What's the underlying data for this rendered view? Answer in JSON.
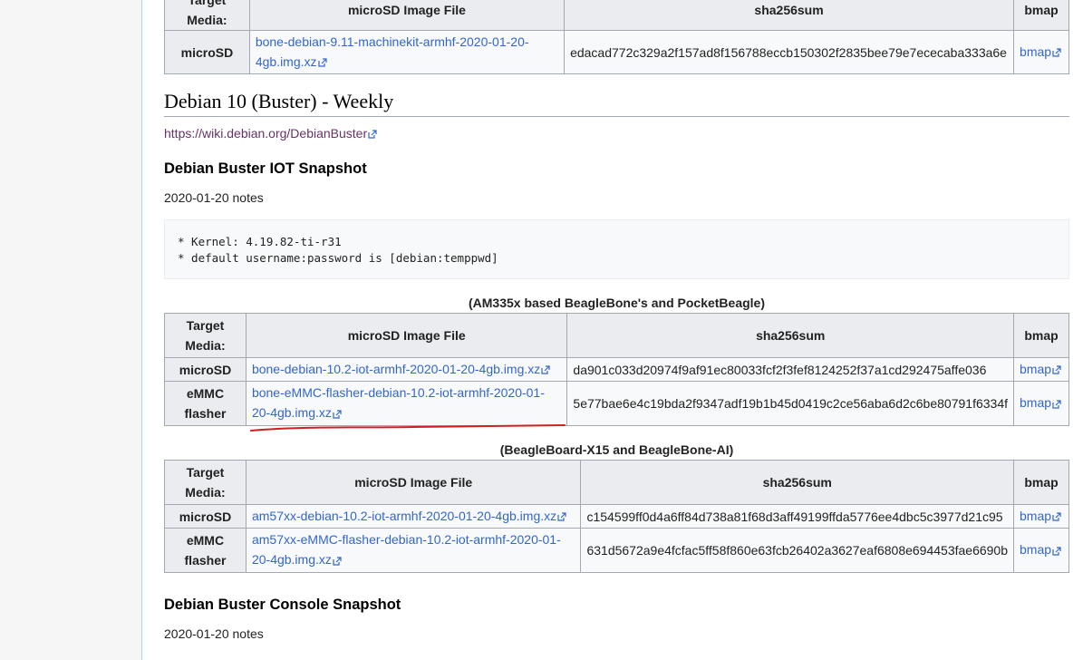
{
  "table_top": {
    "headers": [
      "Target Media:",
      "microSD Image File",
      "sha256sum",
      "bmap"
    ],
    "rows": [
      {
        "media": "microSD",
        "file": "bone-debian-9.11-machinekit-armhf-2020-01-20-4gb.img.xz",
        "sha": "edacad772c329a2f157ad8f156788eccb150302f2835bee79e7ececaba333a6e",
        "bmap": "bmap"
      }
    ]
  },
  "section": {
    "title": "Debian 10 (Buster) - Weekly",
    "link": "https://wiki.debian.org/DebianBuster"
  },
  "iot": {
    "title": "Debian Buster IOT Snapshot",
    "notes": "2020-01-20 notes",
    "pre_line1": "* Kernel: 4.19.82-ti-r31",
    "pre_line2": "* default username:password is [debian:temppwd]"
  },
  "table_am335x": {
    "caption": "(AM335x based BeagleBone's and PocketBeagle)",
    "headers": [
      "Target Media:",
      "microSD Image File",
      "sha256sum",
      "bmap"
    ],
    "rows": [
      {
        "media": "microSD",
        "file": "bone-debian-10.2-iot-armhf-2020-01-20-4gb.img.xz",
        "sha": "da901c033d20974f9af91ec80033fcf2f3fef8124252f37a1cd292475affe036",
        "bmap": "bmap"
      },
      {
        "media": "eMMC flasher",
        "file": "bone-eMMC-flasher-debian-10.2-iot-armhf-2020-01-20-4gb.img.xz",
        "sha": "5e77bae6e4c19bda2f9347adf19b1b45d0419c2ce56aba6d2c6be80791f6334f",
        "bmap": "bmap"
      }
    ]
  },
  "table_x15": {
    "caption": "(BeagleBoard-X15 and BeagleBone-AI)",
    "headers": [
      "Target Media:",
      "microSD Image File",
      "sha256sum",
      "bmap"
    ],
    "rows": [
      {
        "media": "microSD",
        "file": "am57xx-debian-10.2-iot-armhf-2020-01-20-4gb.img.xz",
        "sha": "c154599ff0d4a6ff84d738a81f68d3aff49199ffda5776ee4dbc5c3977d21c95",
        "bmap": "bmap"
      },
      {
        "media": "eMMC flasher",
        "file": "am57xx-eMMC-flasher-debian-10.2-iot-armhf-2020-01-20-4gb.img.xz",
        "sha": "631d5672a9e4fcfac5ff58f860e63fcb26402a3627eaf6808e694453fae6690b",
        "bmap": "bmap"
      }
    ]
  },
  "console": {
    "title": "Debian Buster Console Snapshot",
    "notes": "2020-01-20 notes"
  },
  "colors": {
    "link": "#3366cc",
    "annotation": "#d11f1f"
  },
  "icons": {
    "external_link": "external-link-icon"
  }
}
